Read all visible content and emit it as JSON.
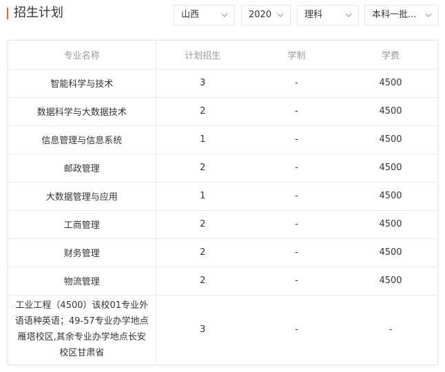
{
  "header": {
    "title": "招生计划"
  },
  "filters": {
    "province": "山西",
    "year": "2020",
    "subject": "理科",
    "batch": "本科一批..."
  },
  "table": {
    "columns": [
      "专业名称",
      "计划招生",
      "学制",
      "学费"
    ],
    "rows": [
      {
        "major": "智能科学与技术",
        "plan": "3",
        "duration": "-",
        "fee": "4500"
      },
      {
        "major": "数据科学与大数据技术",
        "plan": "2",
        "duration": "-",
        "fee": "4500"
      },
      {
        "major": "信息管理与信息系统",
        "plan": "1",
        "duration": "-",
        "fee": "4500"
      },
      {
        "major": "邮政管理",
        "plan": "2",
        "duration": "-",
        "fee": "4500"
      },
      {
        "major": "大数据管理与应用",
        "plan": "1",
        "duration": "-",
        "fee": "4500"
      },
      {
        "major": "工商管理",
        "plan": "2",
        "duration": "-",
        "fee": "4500"
      },
      {
        "major": "财务管理",
        "plan": "2",
        "duration": "-",
        "fee": "4500"
      },
      {
        "major": "物流管理",
        "plan": "2",
        "duration": "-",
        "fee": "4500"
      },
      {
        "major": "工业工程（4500）该校01专业外语语种英语；49-57专业办学地点雁塔校区,其余专业办学地点长安校区甘肃省",
        "plan": "3",
        "duration": "-",
        "fee": "-"
      }
    ]
  },
  "colors": {
    "accent": "#f26522"
  }
}
